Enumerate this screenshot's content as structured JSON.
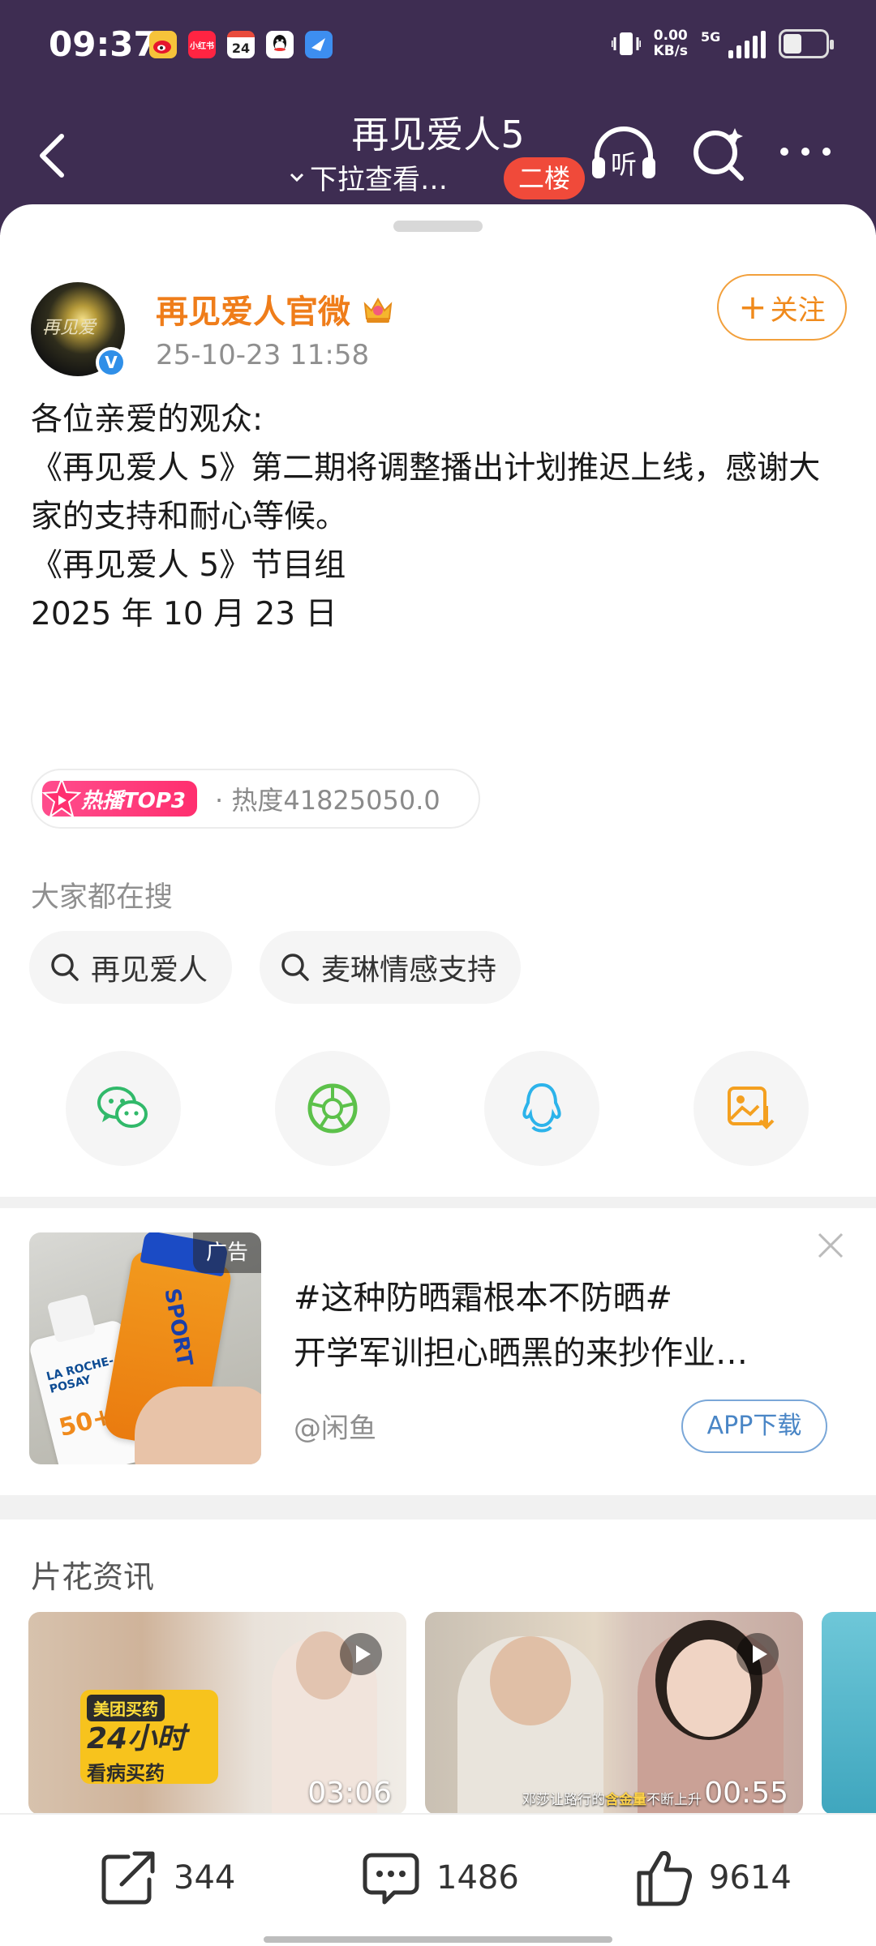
{
  "status_bar": {
    "time": "09:37",
    "app_icons": [
      "weibo-icon",
      "xiaohongshu-icon",
      "calendar-icon",
      "qq-icon",
      "mail-icon"
    ],
    "xhs_label": "小红书",
    "calendar_day": "24",
    "net_speed_value": "0.00",
    "net_speed_unit": "KB/s",
    "network": "5G"
  },
  "navbar": {
    "title": "再见爱人5",
    "subtitle": "下拉查看…",
    "badge": "二楼",
    "listen_label": "听"
  },
  "post": {
    "author": "再见爱人官微",
    "avatar_text": "再见爱",
    "verified_badge": "V",
    "date": "25-10-23 11:58",
    "follow_label": "关注",
    "body_lines": [
      "各位亲爱的观众:",
      "",
      "《再见爱人 5》第二期将调整播出计划推迟上线，感谢大家的支持和耐心等候。",
      "",
      "《再见爱人 5》节目组",
      "2025 年 10 月 23 日"
    ],
    "hot_badge": "热播TOP3",
    "hot_value": "· 热度41825050.0"
  },
  "searches": {
    "label": "大家都在搜",
    "chips": [
      "再见爱人",
      "麦琳情感支持"
    ]
  },
  "share_icons": [
    "wechat-icon",
    "moments-icon",
    "qq-icon",
    "save-image-icon"
  ],
  "ad": {
    "tag": "广告",
    "title": "#这种防晒霜根本不防晒#",
    "description": "开学军训担心晒黑的来抄作业…",
    "source": "@闲鱼",
    "button": "APP下载",
    "image_texts": {
      "bottle1_brand": "LA ROCHE-POSAY",
      "bottle1_spf": "50+",
      "bottle2_brand": "SPORT"
    }
  },
  "clips": {
    "title": "片花资讯",
    "items": [
      {
        "duration": "03:06",
        "promo_brand": "美团买药",
        "promo_main": "24小时",
        "promo_sub": "看病买药"
      },
      {
        "duration": "00:55",
        "caption_pre": "邓莎让路行的",
        "caption_hl": "含金量",
        "caption_post": "不断上升"
      }
    ]
  },
  "actions": {
    "reposts": "344",
    "comments": "1486",
    "likes": "9614"
  },
  "colors": {
    "header_bg": "#3e2d52",
    "author_orange": "#ef7d1a",
    "hot_pink": "#ff3a7a",
    "badge_red": "#f04a3a",
    "link_blue": "#4a86c6"
  }
}
